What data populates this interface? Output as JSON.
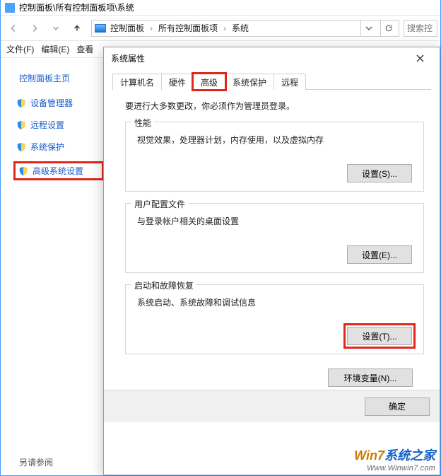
{
  "titlebar": {
    "path": "控制面板\\所有控制面板项\\系统"
  },
  "breadcrumb": {
    "l1": "控制面板",
    "l2": "所有控制面板项",
    "l3": "系统"
  },
  "search": {
    "placeholder": "搜索控"
  },
  "menu": {
    "file": "文件(F)",
    "edit": "编辑(E)",
    "view": "查看"
  },
  "sidebar": {
    "home": "控制面板主页",
    "items": [
      {
        "label": "设备管理器"
      },
      {
        "label": "远程设置"
      },
      {
        "label": "系统保护"
      },
      {
        "label": "高级系统设置"
      }
    ],
    "see_also": "另请参阅"
  },
  "dialog": {
    "title": "系统属性",
    "tabs": {
      "t1": "计算机名",
      "t2": "硬件",
      "t3": "高级",
      "t4": "系统保护",
      "t5": "远程"
    },
    "hint": "要进行大多数更改，你必须作为管理员登录。",
    "perf": {
      "title": "性能",
      "desc": "视觉效果，处理器计划，内存使用，以及虚拟内存",
      "btn": "设置(S)..."
    },
    "profile": {
      "title": "用户配置文件",
      "desc": "与登录帐户相关的桌面设置",
      "btn": "设置(E)..."
    },
    "startup": {
      "title": "启动和故障恢复",
      "desc": "系统启动、系统故障和调试信息",
      "btn": "设置(T)..."
    },
    "env_btn": "环境变量(N)...",
    "ok": "确定"
  },
  "watermark": {
    "brand_a": "Win7",
    "brand_b": "系统之家",
    "url": "Www.Winwin7.com"
  }
}
